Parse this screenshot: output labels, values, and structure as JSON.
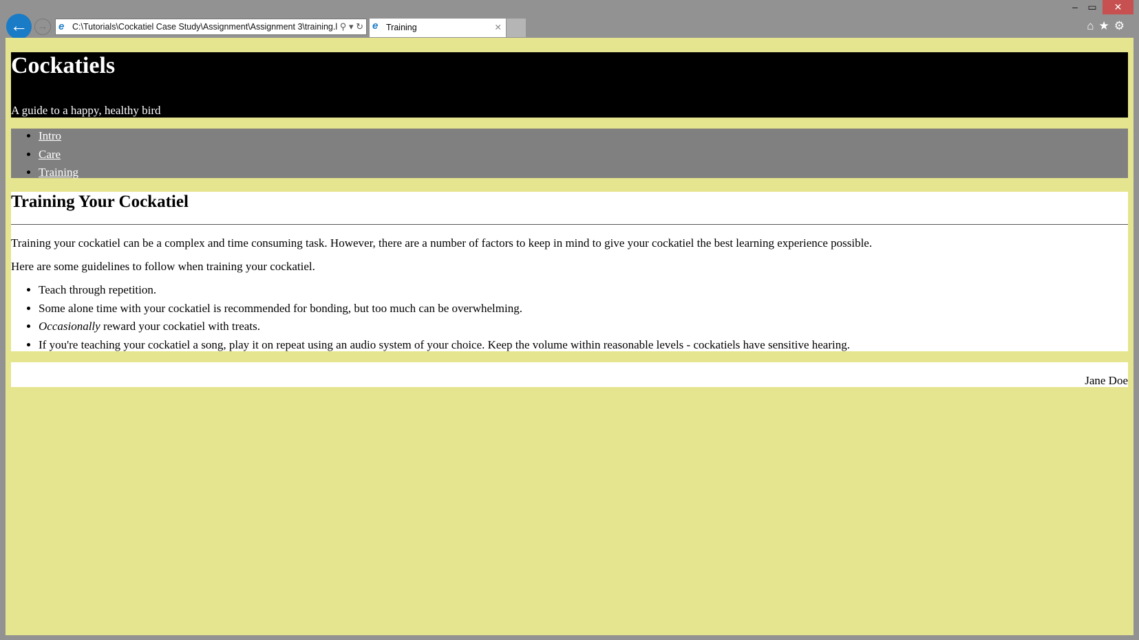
{
  "browser": {
    "address": "C:\\Tutorials\\Cockatiel Case Study\\Assignment\\Assignment 3\\training.l",
    "tab_title": "Training",
    "colors": {
      "close": "#c75050",
      "back": "#1a7bc7"
    }
  },
  "page": {
    "header": {
      "title": "Cockatiels",
      "tagline": "A guide to a happy, healthy bird"
    },
    "nav": [
      {
        "label": "Intro"
      },
      {
        "label": "Care"
      },
      {
        "label": "Training"
      }
    ],
    "main": {
      "heading": "Training Your Cockatiel",
      "para1": "Training your cockatiel can be a complex and time consuming task. However, there are a number of factors to keep in mind to give your cockatiel the best learning experience possible.",
      "para2": "Here are some guidelines to follow when training your cockatiel.",
      "items": [
        {
          "text": "Teach through repetition."
        },
        {
          "text": "Some alone time with your cockatiel is recommended for bonding, but too much can be overwhelming."
        },
        {
          "em": "Occasionally",
          "text": " reward your cockatiel with treats."
        },
        {
          "text": "If you're teaching your cockatiel a song, play it on repeat using an audio system of your choice. Keep the volume within reasonable levels - cockatiels have sensitive hearing."
        }
      ]
    },
    "footer": {
      "author": "Jane Doe"
    },
    "colors": {
      "background": "#e6e58f",
      "header": "#000000",
      "nav": "#808080",
      "content": "#ffffff"
    }
  }
}
